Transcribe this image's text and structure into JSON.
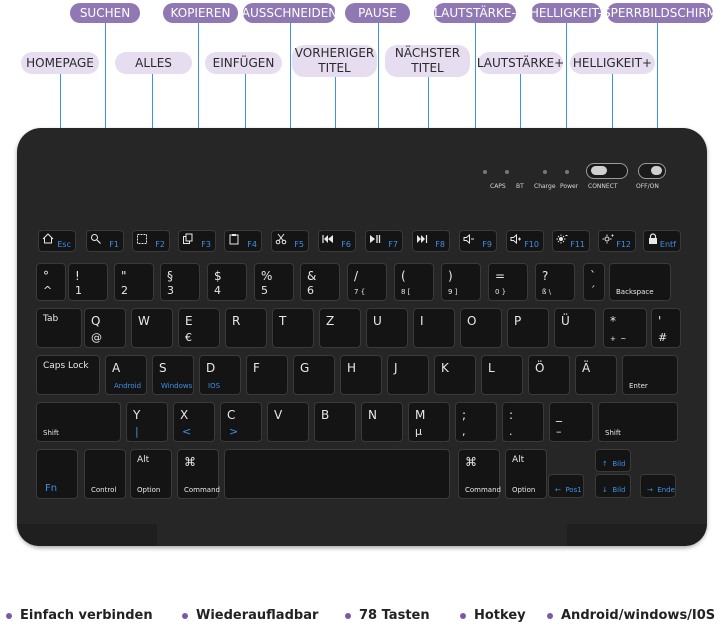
{
  "callouts_top": [
    "SUCHEN",
    "KOPIEREN",
    "AUSSCHNEIDEN",
    "PAUSE",
    "LAUTSTÄRKE-",
    "HELLIGKEIT-",
    "SPERRBILDSCHIRM"
  ],
  "callouts_mid": [
    "HOMEPAGE",
    "ALLES",
    "EINFÜGEN",
    "VORHERIGER\nTITEL",
    "NÄCHSTER\nTITEL",
    "LAUTSTÄRKE+",
    "HELLIGKEIT+"
  ],
  "indicators": [
    "CAPS",
    "BT",
    "Charge",
    "Power"
  ],
  "switches": [
    "CONNECT",
    "OFF/ON"
  ],
  "fkeys": [
    {
      "icon": "home-icon",
      "label": "Esc"
    },
    {
      "icon": "search-icon",
      "label": "F1"
    },
    {
      "icon": "select-all-icon",
      "label": "F2"
    },
    {
      "icon": "copy-icon",
      "label": "F3"
    },
    {
      "icon": "paste-icon",
      "label": "F4"
    },
    {
      "icon": "scissors-icon",
      "label": "F5"
    },
    {
      "icon": "previous-track-icon",
      "label": "F6"
    },
    {
      "icon": "play-pause-icon",
      "label": "F7"
    },
    {
      "icon": "next-track-icon",
      "label": "F8"
    },
    {
      "icon": "volume-down-icon",
      "label": "F9"
    },
    {
      "icon": "volume-up-icon",
      "label": "F10"
    },
    {
      "icon": "brightness-down-icon",
      "label": "F11"
    },
    {
      "icon": "brightness-up-icon",
      "label": "F12"
    },
    {
      "icon": "lock-icon",
      "label": "Entf"
    }
  ],
  "row1": [
    {
      "tl": "°",
      "bl": "^"
    },
    {
      "tl": "!",
      "bl": "1"
    },
    {
      "tl": "\"",
      "bl": "2"
    },
    {
      "tl": "§",
      "bl": "3"
    },
    {
      "tl": "$",
      "bl": "4"
    },
    {
      "tl": "%",
      "bl": "5"
    },
    {
      "tl": "&",
      "bl": "6"
    },
    {
      "tl": "/",
      "bl": "7 {"
    },
    {
      "tl": "(",
      "bl": "8 ["
    },
    {
      "tl": ")",
      "bl": "9 ]"
    },
    {
      "tl": "=",
      "bl": "0 }"
    },
    {
      "tl": "?",
      "bl": "ß \\"
    },
    {
      "tl": "`",
      "bl": "´"
    },
    {
      "tl": "",
      "bl": "Backspace"
    }
  ],
  "row2": [
    {
      "tl": "Tab",
      "bl": ""
    },
    {
      "tl": "Q",
      "bl": "@"
    },
    {
      "tl": "W",
      "bl": ""
    },
    {
      "tl": "E",
      "bl": "€"
    },
    {
      "tl": "R",
      "bl": ""
    },
    {
      "tl": "T",
      "bl": ""
    },
    {
      "tl": "Z",
      "bl": ""
    },
    {
      "tl": "U",
      "bl": ""
    },
    {
      "tl": "I",
      "bl": ""
    },
    {
      "tl": "O",
      "bl": ""
    },
    {
      "tl": "P",
      "bl": ""
    },
    {
      "tl": "Ü",
      "bl": ""
    },
    {
      "tl": "*",
      "bl": "+  ~"
    },
    {
      "tl": "'",
      "bl": "#"
    }
  ],
  "row3": [
    {
      "tl": "Caps Lock",
      "bl": ""
    },
    {
      "tl": "A",
      "bl": "Android"
    },
    {
      "tl": "S",
      "bl": "Windows"
    },
    {
      "tl": "D",
      "bl": "IOS"
    },
    {
      "tl": "F",
      "bl": ""
    },
    {
      "tl": "G",
      "bl": ""
    },
    {
      "tl": "H",
      "bl": ""
    },
    {
      "tl": "J",
      "bl": ""
    },
    {
      "tl": "K",
      "bl": ""
    },
    {
      "tl": "L",
      "bl": ""
    },
    {
      "tl": "Ö",
      "bl": ""
    },
    {
      "tl": "Ä",
      "bl": ""
    },
    {
      "tl": "",
      "bl": "Enter"
    }
  ],
  "row4": [
    {
      "tl": "",
      "bl": "Shift"
    },
    {
      "tl": "Y",
      "bl": "|"
    },
    {
      "tl": "X",
      "bl": "<"
    },
    {
      "tl": "C",
      "bl": ">"
    },
    {
      "tl": "V",
      "bl": ""
    },
    {
      "tl": "B",
      "bl": ""
    },
    {
      "tl": "N",
      "bl": ""
    },
    {
      "tl": "M",
      "bl": "µ"
    },
    {
      "tl": ";",
      "bl": ","
    },
    {
      "tl": ":",
      "bl": "."
    },
    {
      "tl": "_",
      "bl": "–"
    },
    {
      "tl": "",
      "bl": "Shift"
    }
  ],
  "row5": [
    {
      "tl": "",
      "bl": "Fn"
    },
    {
      "tl": "",
      "bl": "Control"
    },
    {
      "tl": "Alt",
      "bl": "Option"
    },
    {
      "tl": "⌘",
      "bl": "Command"
    },
    {
      "tl": "",
      "bl": ""
    },
    {
      "tl": "⌘",
      "bl": "Command"
    },
    {
      "tl": "Alt",
      "bl": "Option"
    },
    {
      "tl": "",
      "bl": "←  Pos1"
    },
    {
      "tl": "",
      "bl": "↑  Bild"
    },
    {
      "tl": "",
      "bl": "↓  Bild"
    },
    {
      "tl": "",
      "bl": "→  Ende"
    }
  ],
  "features": [
    "Einfach verbinden",
    "Wiederaufladbar",
    "78 Tasten",
    "Hotkey",
    "Android/windows/I0S"
  ],
  "colors": {
    "accent": "#8f78b4",
    "callout_light": "#e7ddf0",
    "keyboard": "#262626",
    "key": "#141414",
    "blue_legend": "#3d8fe6",
    "leader": "#3b96df"
  }
}
